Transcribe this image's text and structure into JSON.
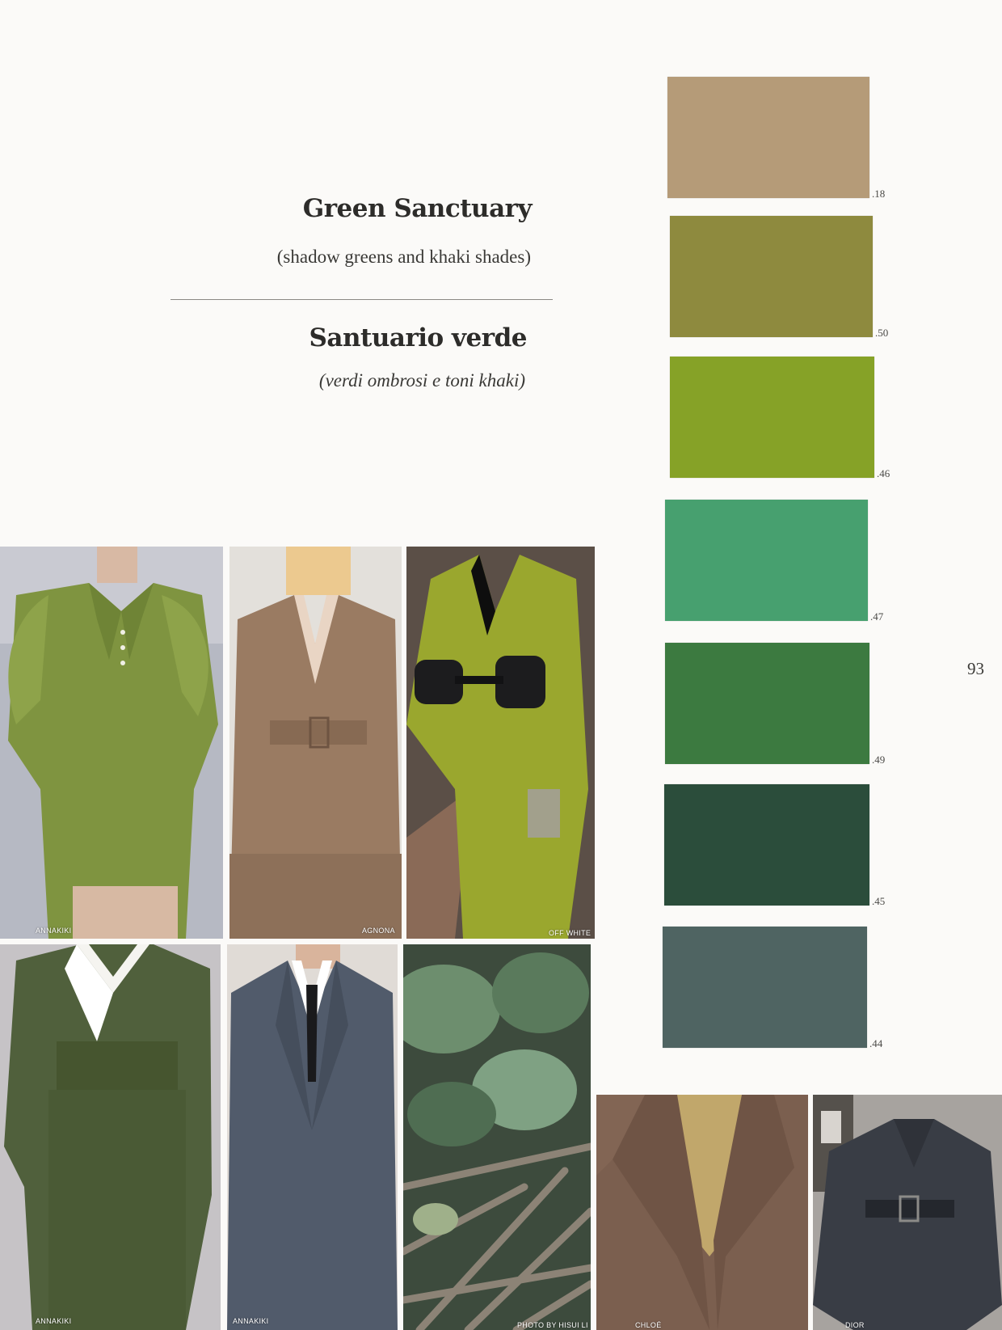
{
  "header": {
    "title_en": "Green Sanctuary",
    "subtitle_en": "(shadow greens and khaki shades)",
    "title_it": "Santuario verde",
    "subtitle_it": "(verdi ombrosi e toni khaki)"
  },
  "swatches": [
    {
      "code": ".18",
      "color": "#b59b78"
    },
    {
      "code": ".50",
      "color": "#8e8a3e"
    },
    {
      "code": ".46",
      "color": "#86a227"
    },
    {
      "code": ".47",
      "color": "#47a06f"
    },
    {
      "code": ".49",
      "color": "#3c7a40"
    },
    {
      "code": ".45",
      "color": "#2b4d3b"
    },
    {
      "code": ".44",
      "color": "#4f6462"
    }
  ],
  "page_number": "93",
  "photos": [
    {
      "credit": "ANNAKIKI",
      "icon": "green-leather-dress-photo"
    },
    {
      "credit": "AGNONA",
      "icon": "camel-belted-suit-photo"
    },
    {
      "credit": "OFF WHITE",
      "icon": "lime-suit-photo"
    },
    {
      "credit": "ANNAKIKI",
      "icon": "olive-suit-photo"
    },
    {
      "credit": "ANNAKIKI",
      "icon": "slate-blazer-photo"
    },
    {
      "credit": "PHOTO BY HISUI LI",
      "icon": "leaves-and-sticks-photo"
    },
    {
      "credit": "CHLOÉ",
      "icon": "brown-tweed-jacket-photo"
    },
    {
      "credit": "DIOR",
      "icon": "grey-belted-coat-photo"
    }
  ]
}
